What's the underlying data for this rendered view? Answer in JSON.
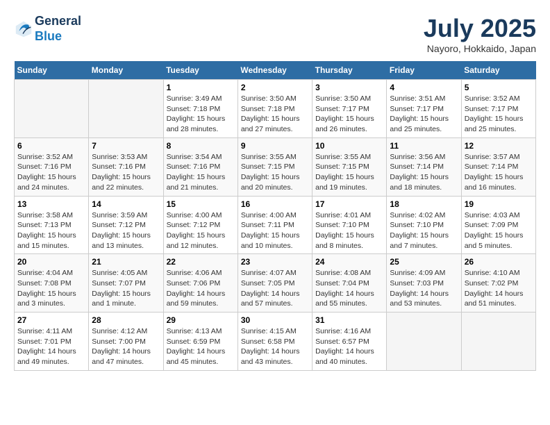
{
  "header": {
    "logo": {
      "line1": "General",
      "line2": "Blue"
    },
    "title": "July 2025",
    "location": "Nayoro, Hokkaido, Japan"
  },
  "weekdays": [
    "Sunday",
    "Monday",
    "Tuesday",
    "Wednesday",
    "Thursday",
    "Friday",
    "Saturday"
  ],
  "weeks": [
    [
      {
        "day": "",
        "info": ""
      },
      {
        "day": "",
        "info": ""
      },
      {
        "day": "1",
        "info": "Sunrise: 3:49 AM\nSunset: 7:18 PM\nDaylight: 15 hours\nand 28 minutes."
      },
      {
        "day": "2",
        "info": "Sunrise: 3:50 AM\nSunset: 7:18 PM\nDaylight: 15 hours\nand 27 minutes."
      },
      {
        "day": "3",
        "info": "Sunrise: 3:50 AM\nSunset: 7:17 PM\nDaylight: 15 hours\nand 26 minutes."
      },
      {
        "day": "4",
        "info": "Sunrise: 3:51 AM\nSunset: 7:17 PM\nDaylight: 15 hours\nand 25 minutes."
      },
      {
        "day": "5",
        "info": "Sunrise: 3:52 AM\nSunset: 7:17 PM\nDaylight: 15 hours\nand 25 minutes."
      }
    ],
    [
      {
        "day": "6",
        "info": "Sunrise: 3:52 AM\nSunset: 7:16 PM\nDaylight: 15 hours\nand 24 minutes."
      },
      {
        "day": "7",
        "info": "Sunrise: 3:53 AM\nSunset: 7:16 PM\nDaylight: 15 hours\nand 22 minutes."
      },
      {
        "day": "8",
        "info": "Sunrise: 3:54 AM\nSunset: 7:16 PM\nDaylight: 15 hours\nand 21 minutes."
      },
      {
        "day": "9",
        "info": "Sunrise: 3:55 AM\nSunset: 7:15 PM\nDaylight: 15 hours\nand 20 minutes."
      },
      {
        "day": "10",
        "info": "Sunrise: 3:55 AM\nSunset: 7:15 PM\nDaylight: 15 hours\nand 19 minutes."
      },
      {
        "day": "11",
        "info": "Sunrise: 3:56 AM\nSunset: 7:14 PM\nDaylight: 15 hours\nand 18 minutes."
      },
      {
        "day": "12",
        "info": "Sunrise: 3:57 AM\nSunset: 7:14 PM\nDaylight: 15 hours\nand 16 minutes."
      }
    ],
    [
      {
        "day": "13",
        "info": "Sunrise: 3:58 AM\nSunset: 7:13 PM\nDaylight: 15 hours\nand 15 minutes."
      },
      {
        "day": "14",
        "info": "Sunrise: 3:59 AM\nSunset: 7:12 PM\nDaylight: 15 hours\nand 13 minutes."
      },
      {
        "day": "15",
        "info": "Sunrise: 4:00 AM\nSunset: 7:12 PM\nDaylight: 15 hours\nand 12 minutes."
      },
      {
        "day": "16",
        "info": "Sunrise: 4:00 AM\nSunset: 7:11 PM\nDaylight: 15 hours\nand 10 minutes."
      },
      {
        "day": "17",
        "info": "Sunrise: 4:01 AM\nSunset: 7:10 PM\nDaylight: 15 hours\nand 8 minutes."
      },
      {
        "day": "18",
        "info": "Sunrise: 4:02 AM\nSunset: 7:10 PM\nDaylight: 15 hours\nand 7 minutes."
      },
      {
        "day": "19",
        "info": "Sunrise: 4:03 AM\nSunset: 7:09 PM\nDaylight: 15 hours\nand 5 minutes."
      }
    ],
    [
      {
        "day": "20",
        "info": "Sunrise: 4:04 AM\nSunset: 7:08 PM\nDaylight: 15 hours\nand 3 minutes."
      },
      {
        "day": "21",
        "info": "Sunrise: 4:05 AM\nSunset: 7:07 PM\nDaylight: 15 hours\nand 1 minute."
      },
      {
        "day": "22",
        "info": "Sunrise: 4:06 AM\nSunset: 7:06 PM\nDaylight: 14 hours\nand 59 minutes."
      },
      {
        "day": "23",
        "info": "Sunrise: 4:07 AM\nSunset: 7:05 PM\nDaylight: 14 hours\nand 57 minutes."
      },
      {
        "day": "24",
        "info": "Sunrise: 4:08 AM\nSunset: 7:04 PM\nDaylight: 14 hours\nand 55 minutes."
      },
      {
        "day": "25",
        "info": "Sunrise: 4:09 AM\nSunset: 7:03 PM\nDaylight: 14 hours\nand 53 minutes."
      },
      {
        "day": "26",
        "info": "Sunrise: 4:10 AM\nSunset: 7:02 PM\nDaylight: 14 hours\nand 51 minutes."
      }
    ],
    [
      {
        "day": "27",
        "info": "Sunrise: 4:11 AM\nSunset: 7:01 PM\nDaylight: 14 hours\nand 49 minutes."
      },
      {
        "day": "28",
        "info": "Sunrise: 4:12 AM\nSunset: 7:00 PM\nDaylight: 14 hours\nand 47 minutes."
      },
      {
        "day": "29",
        "info": "Sunrise: 4:13 AM\nSunset: 6:59 PM\nDaylight: 14 hours\nand 45 minutes."
      },
      {
        "day": "30",
        "info": "Sunrise: 4:15 AM\nSunset: 6:58 PM\nDaylight: 14 hours\nand 43 minutes."
      },
      {
        "day": "31",
        "info": "Sunrise: 4:16 AM\nSunset: 6:57 PM\nDaylight: 14 hours\nand 40 minutes."
      },
      {
        "day": "",
        "info": ""
      },
      {
        "day": "",
        "info": ""
      }
    ]
  ]
}
